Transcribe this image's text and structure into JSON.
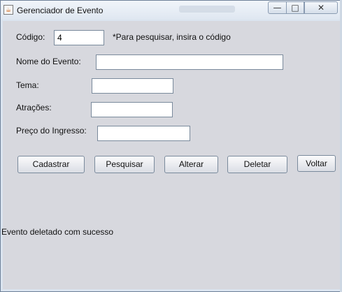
{
  "window": {
    "title": "Gerenciador de Evento",
    "min_glyph": "—",
    "max_glyph": "□",
    "close_glyph": "✕"
  },
  "form": {
    "codigo_label": "Código:",
    "codigo_value": "4",
    "search_hint": "*Para pesquisar, insira o código",
    "nome_label": "Nome do Evento:",
    "nome_value": "",
    "tema_label": "Tema:",
    "tema_value": "",
    "atracoes_label": "Atrações:",
    "atracoes_value": "",
    "preco_label": "Preço do Ingresso:",
    "preco_value": ""
  },
  "buttons": {
    "cadastrar": "Cadastrar",
    "pesquisar": "Pesquisar",
    "alterar": "Alterar",
    "deletar": "Deletar",
    "voltar": "Voltar"
  },
  "status": {
    "message": "Evento deletado com sucesso"
  }
}
